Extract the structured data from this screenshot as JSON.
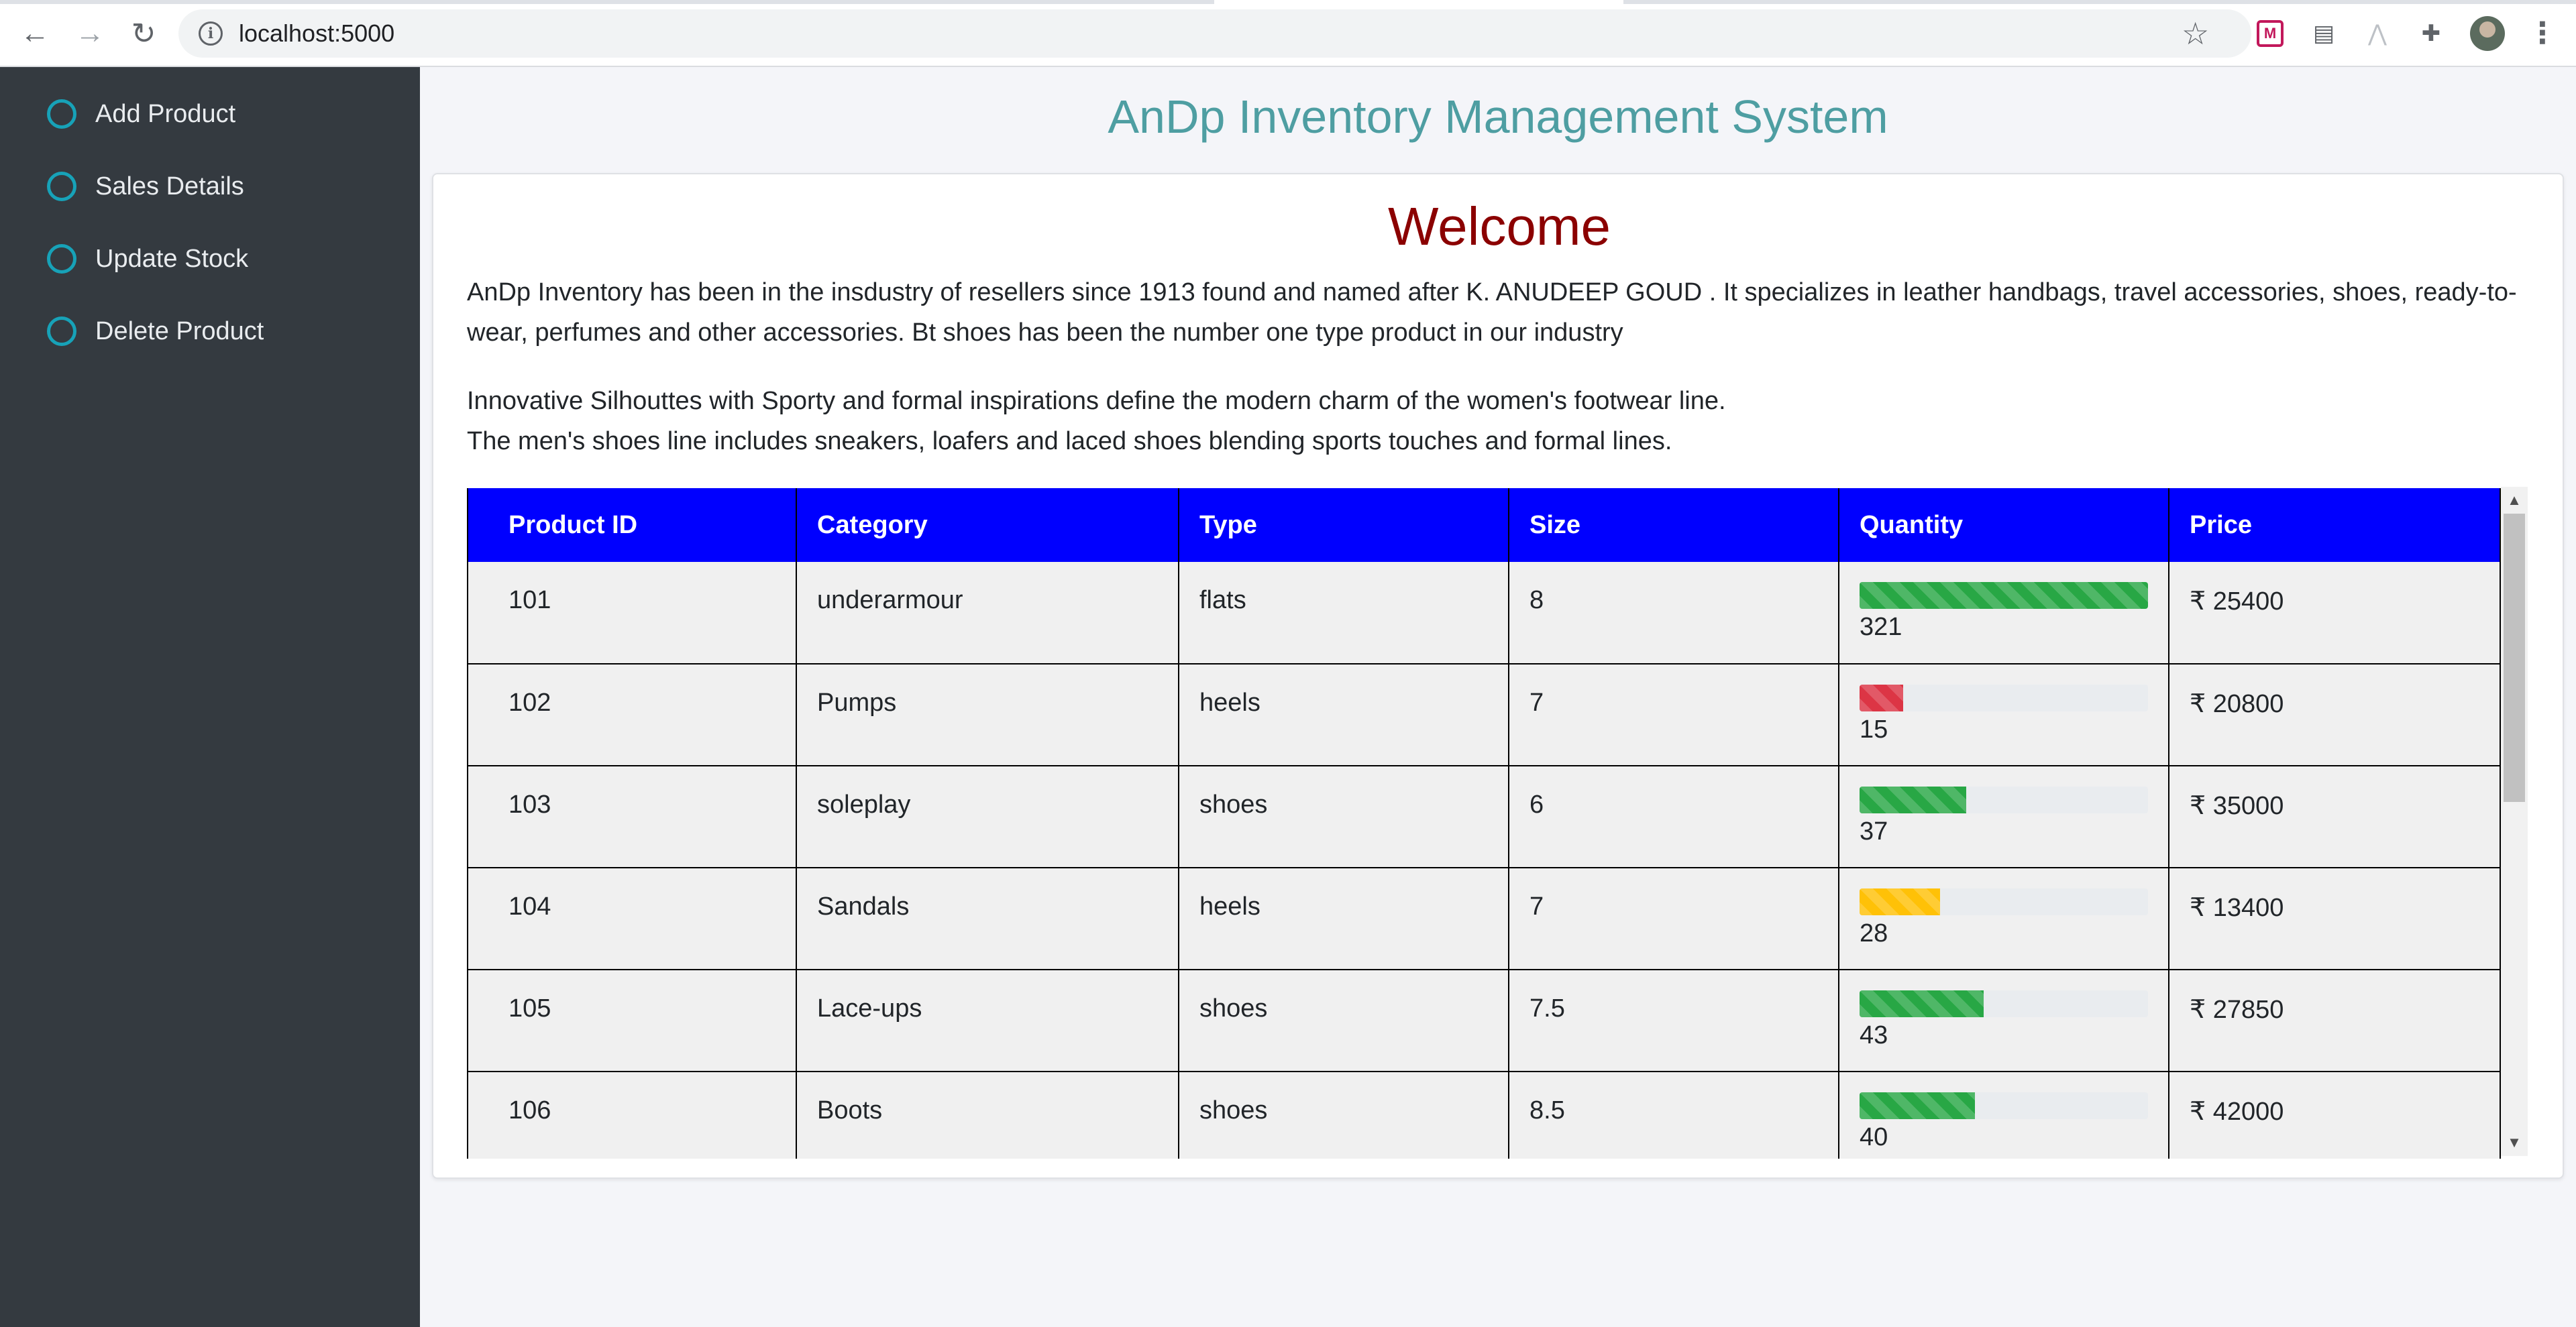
{
  "browser": {
    "url": "localhost:5000"
  },
  "sidebar": {
    "items": [
      {
        "label": "Add Product"
      },
      {
        "label": "Sales Details"
      },
      {
        "label": "Update Stock"
      },
      {
        "label": "Delete Product"
      }
    ]
  },
  "header": {
    "title": "AnDp Inventory Management System"
  },
  "content": {
    "welcome": "Welcome",
    "paragraph1": "AnDp Inventory has been in the insdustry of resellers since 1913 found and named after K. ANUDEEP GOUD . It specializes in leather handbags, travel accessories, shoes, ready-to-wear, perfumes and other accessories. Bt shoes has been the number one type product in our industry",
    "paragraph2_line1": "Innovative Silhouttes with Sporty and formal inspirations define the modern charm of the women's footwear line.",
    "paragraph2_line2": "The men's shoes line includes sneakers, loafers and laced shoes blending sports touches and formal lines."
  },
  "table": {
    "columns": [
      "Product ID",
      "Category",
      "Type",
      "Size",
      "Quantity",
      "Price"
    ],
    "rows": [
      {
        "id": "101",
        "category": "underarmour",
        "type": "flats",
        "size": "8",
        "quantity": "321",
        "fill_percent": 100,
        "bar_color": "#28a745",
        "price": "₹ 25400"
      },
      {
        "id": "102",
        "category": "Pumps",
        "type": "heels",
        "size": "7",
        "quantity": "15",
        "fill_percent": 15,
        "bar_color": "#dc3545",
        "price": "₹ 20800"
      },
      {
        "id": "103",
        "category": "soleplay",
        "type": "shoes",
        "size": "6",
        "quantity": "37",
        "fill_percent": 37,
        "bar_color": "#28a745",
        "price": "₹ 35000"
      },
      {
        "id": "104",
        "category": "Sandals",
        "type": "heels",
        "size": "7",
        "quantity": "28",
        "fill_percent": 28,
        "bar_color": "#ffc107",
        "price": "₹ 13400"
      },
      {
        "id": "105",
        "category": "Lace-ups",
        "type": "shoes",
        "size": "7.5",
        "quantity": "43",
        "fill_percent": 43,
        "bar_color": "#28a745",
        "price": "₹ 27850"
      },
      {
        "id": "106",
        "category": "Boots",
        "type": "shoes",
        "size": "8.5",
        "quantity": "40",
        "fill_percent": 40,
        "bar_color": "#28a745",
        "price": "₹ 42000"
      }
    ]
  },
  "icons": {
    "back": "back-arrow-icon",
    "forward": "forward-arrow-icon",
    "reload": "reload-icon",
    "info": "info-icon",
    "bookmark": "star-icon",
    "extensions": "puzzle-icon",
    "menu": "more-vertical-icon"
  },
  "colors": {
    "sidebar_bg": "#343a40",
    "sidebar_icon": "#17a2b8",
    "title": "#4e9ea2",
    "welcome": "#8b0000",
    "table_header": "#0000ff"
  }
}
